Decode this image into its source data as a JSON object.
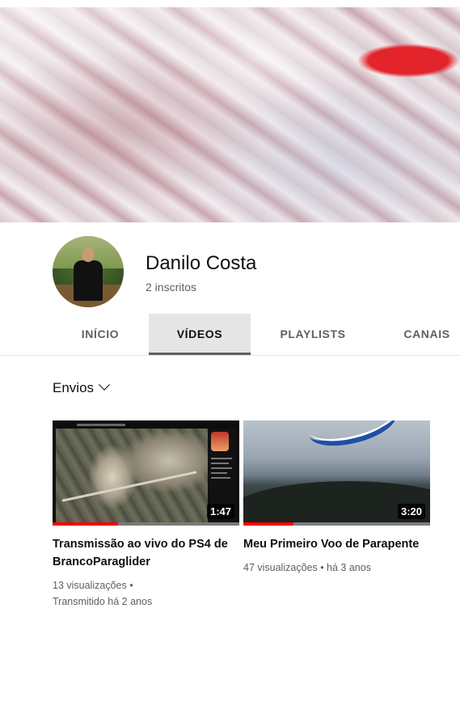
{
  "channel": {
    "name": "Danilo Costa",
    "subscribers": "2 inscritos"
  },
  "tabs": [
    {
      "label": "INÍCIO",
      "active": false
    },
    {
      "label": "VÍDEOS",
      "active": true
    },
    {
      "label": "PLAYLISTS",
      "active": false
    },
    {
      "label": "CANAIS",
      "active": false
    }
  ],
  "sort": {
    "label": "Envios",
    "icon": "chevron-down-icon"
  },
  "videos": [
    {
      "title": "Transmissão ao vivo do PS4 de BrancoParaglider",
      "duration": "1:47",
      "views": "13 visualizações",
      "age": "Transmitido há 2 anos",
      "watched_fraction": 0.35
    },
    {
      "title": "Meu Primeiro Voo de Parapente",
      "duration": "3:20",
      "views": "47 visualizações",
      "age": "há 3 anos",
      "watched_fraction": 0.27
    }
  ],
  "colors": {
    "progress": "#ff0000",
    "active_tab_bg": "#e5e5e5",
    "secondary_text": "#606060"
  }
}
